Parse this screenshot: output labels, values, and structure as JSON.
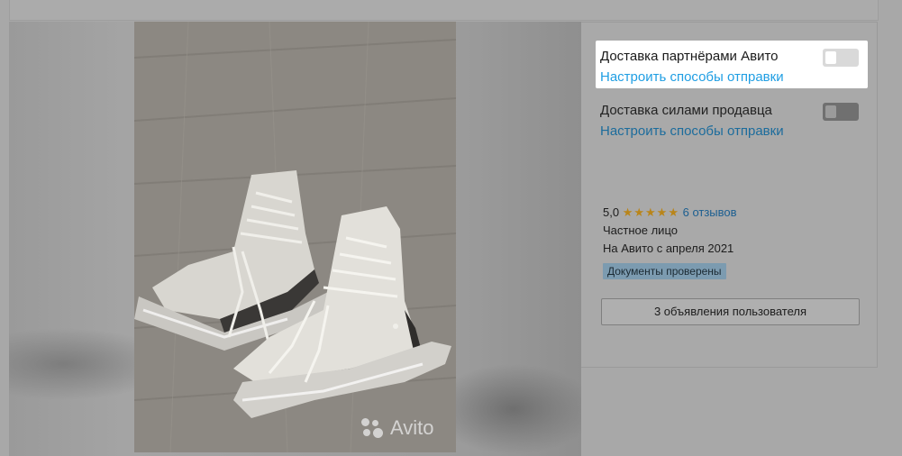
{
  "gallery": {
    "watermark": "Avito"
  },
  "delivery": {
    "partners": {
      "title": "Доставка партнёрами Авито",
      "link": "Настроить способы отправки",
      "enabled": false
    },
    "seller": {
      "title": "Доставка силами продавца",
      "link": "Настроить способы отправки",
      "enabled": false
    }
  },
  "seller": {
    "rating": "5,0",
    "stars": "★★★★★",
    "reviews": "6 отзывов",
    "type": "Частное лицо",
    "since": "На Авито с апреля 2021",
    "badge": "Документы проверены"
  },
  "actions": {
    "user_ads": "3 объявления пользователя"
  },
  "colors": {
    "link": "#1f9ee3",
    "star": "#b9851a",
    "badge": "#7c9bb0"
  }
}
